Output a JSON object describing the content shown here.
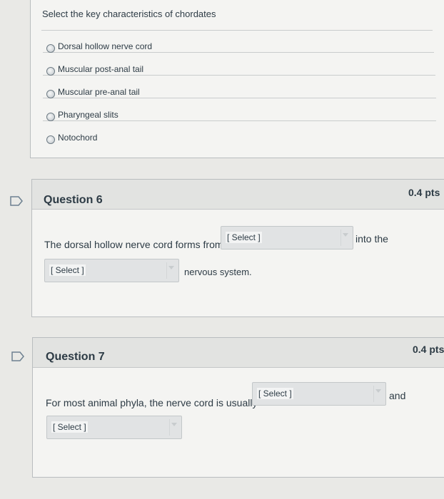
{
  "q5": {
    "prompt": "Select the key characteristics of chordates",
    "options": [
      "Dorsal hollow nerve cord",
      "Muscular post-anal tail",
      "Muscular pre-anal tail",
      "Pharyngeal slits",
      "Notochord"
    ]
  },
  "q6": {
    "title": "Question 6",
    "points": "0.4 pts",
    "text_1": "The dorsal hollow nerve cord forms from",
    "select_1": "[ Select ]",
    "text_2": "into the",
    "select_2": "[ Select ]",
    "text_3": "nervous system."
  },
  "q7": {
    "title": "Question 7",
    "points": "0.4 pts",
    "text_1": "For most animal phyla, the nerve cord is usually",
    "select_1": "[ Select ]",
    "text_2": "and",
    "select_2": "[ Select ]"
  },
  "colors": {
    "page_bg": "#e9e9e6",
    "panel_bg": "#f4f4f2",
    "header_bg": "#e2e3e1",
    "text": "#2d3b45",
    "flag": "#6d8090"
  },
  "icons": {
    "flag": "bookmark-flag-icon",
    "dropdown": "chevron-down-icon",
    "radio": "radio-button"
  }
}
